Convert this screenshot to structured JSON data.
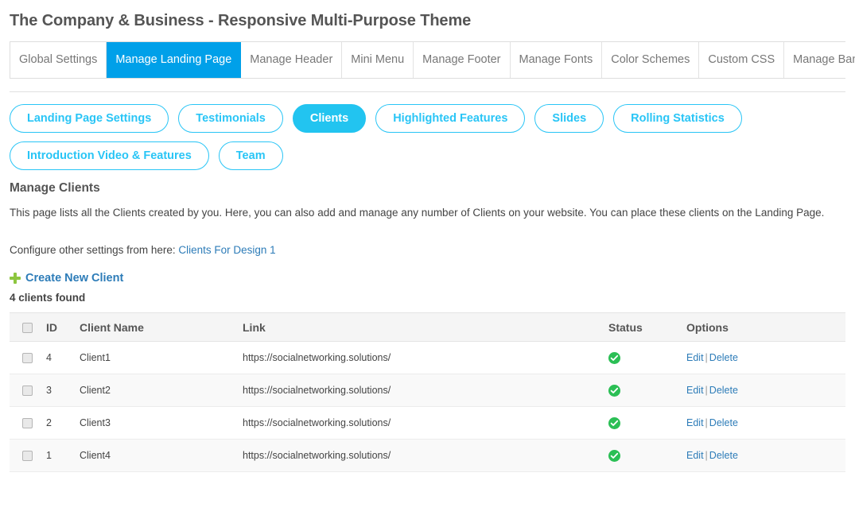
{
  "page_title": "The Company & Business - Responsive Multi-Purpose Theme",
  "colors": {
    "active_tab": "#00a0e9",
    "pill_accent": "#29c5f6",
    "pill_active_bg": "#22c4f0",
    "link": "#2d7cb8",
    "status_green": "#2bbf55",
    "plus_green": "#8dc63f"
  },
  "tabs": [
    {
      "label": "Global Settings",
      "active": false
    },
    {
      "label": "Manage Landing Page",
      "active": true
    },
    {
      "label": "Manage Header",
      "active": false
    },
    {
      "label": "Mini Menu",
      "active": false
    },
    {
      "label": "Manage Footer",
      "active": false
    },
    {
      "label": "Manage Fonts",
      "active": false
    },
    {
      "label": "Color Schemes",
      "active": false
    },
    {
      "label": "Custom CSS",
      "active": false
    },
    {
      "label": "Manage Banners",
      "active": false
    }
  ],
  "pills": {
    "row1": [
      {
        "label": "Landing Page Settings",
        "active": false
      },
      {
        "label": "Testimonials",
        "active": false
      },
      {
        "label": "Clients",
        "active": true
      },
      {
        "label": "Highlighted Features",
        "active": false
      },
      {
        "label": "Slides",
        "active": false
      },
      {
        "label": "Rolling Statistics",
        "active": false
      }
    ],
    "row2": [
      {
        "label": "Introduction Video & Features",
        "active": false
      },
      {
        "label": "Team",
        "active": false
      }
    ]
  },
  "section": {
    "heading": "Manage Clients",
    "description": "This page lists all the Clients created by you. Here, you can also add and manage any number of Clients on your website. You can place these clients on the Landing Page.",
    "configure_prefix": "Configure other settings from here: ",
    "configure_link": "Clients For Design 1",
    "create_label": "Create New Client",
    "found_count": "4 clients found"
  },
  "table": {
    "columns": [
      "",
      "ID",
      "Client Name",
      "Link",
      "Status",
      "Options"
    ],
    "rows": [
      {
        "id": "4",
        "name": "Client1",
        "link": "https://socialnetworking.solutions/",
        "status": "enabled",
        "edit": "Edit",
        "sep": "|",
        "delete": "Delete"
      },
      {
        "id": "3",
        "name": "Client2",
        "link": "https://socialnetworking.solutions/",
        "status": "enabled",
        "edit": "Edit",
        "sep": "|",
        "delete": "Delete"
      },
      {
        "id": "2",
        "name": "Client3",
        "link": "https://socialnetworking.solutions/",
        "status": "enabled",
        "edit": "Edit",
        "sep": "|",
        "delete": "Delete"
      },
      {
        "id": "1",
        "name": "Client4",
        "link": "https://socialnetworking.solutions/",
        "status": "enabled",
        "edit": "Edit",
        "sep": "|",
        "delete": "Delete"
      }
    ]
  }
}
